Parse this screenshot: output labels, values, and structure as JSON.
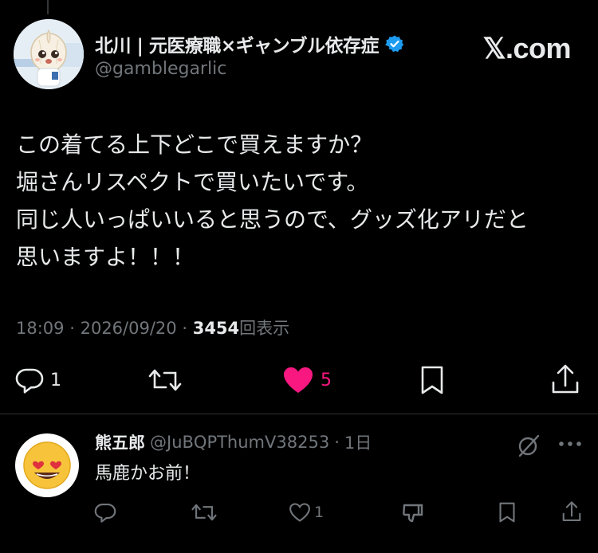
{
  "author": {
    "display_name": "北川 | 元医療職×ギャンブル依存症",
    "handle": "@gamblegarlic",
    "verified": true
  },
  "brand": {
    "label": "𝕏.com"
  },
  "post": {
    "text": "この着てる上下どこで買えますか？\n堀さんリスペクトで買いたいです。\n同じ人いっぱいいると思うので、グッズ化アリだと\n思いますよ！！！",
    "time": "18:09",
    "date": "2026/09/20",
    "sep": "·",
    "views_count": "3454",
    "views_label": "回表示"
  },
  "actions": {
    "replies": "1",
    "retweets": "",
    "likes": "5",
    "liked": true
  },
  "reply": {
    "display_name": "熊五郎",
    "handle": "@JuBQPThumV38253",
    "sep": "·",
    "time": "1日",
    "text": "馬鹿かお前！",
    "likes": "1"
  },
  "colors": {
    "background": "#000000",
    "text": "#e7e9ea",
    "muted": "#71767b",
    "like": "#f91880",
    "verified": "#1d9bf0"
  },
  "icons": {
    "reply": "reply-icon",
    "retweet": "retweet-icon",
    "like": "heart-icon",
    "bookmark": "bookmark-icon",
    "share": "share-icon",
    "grok": "grok-icon",
    "more": "more-icon",
    "dislike": "dislike-icon"
  }
}
